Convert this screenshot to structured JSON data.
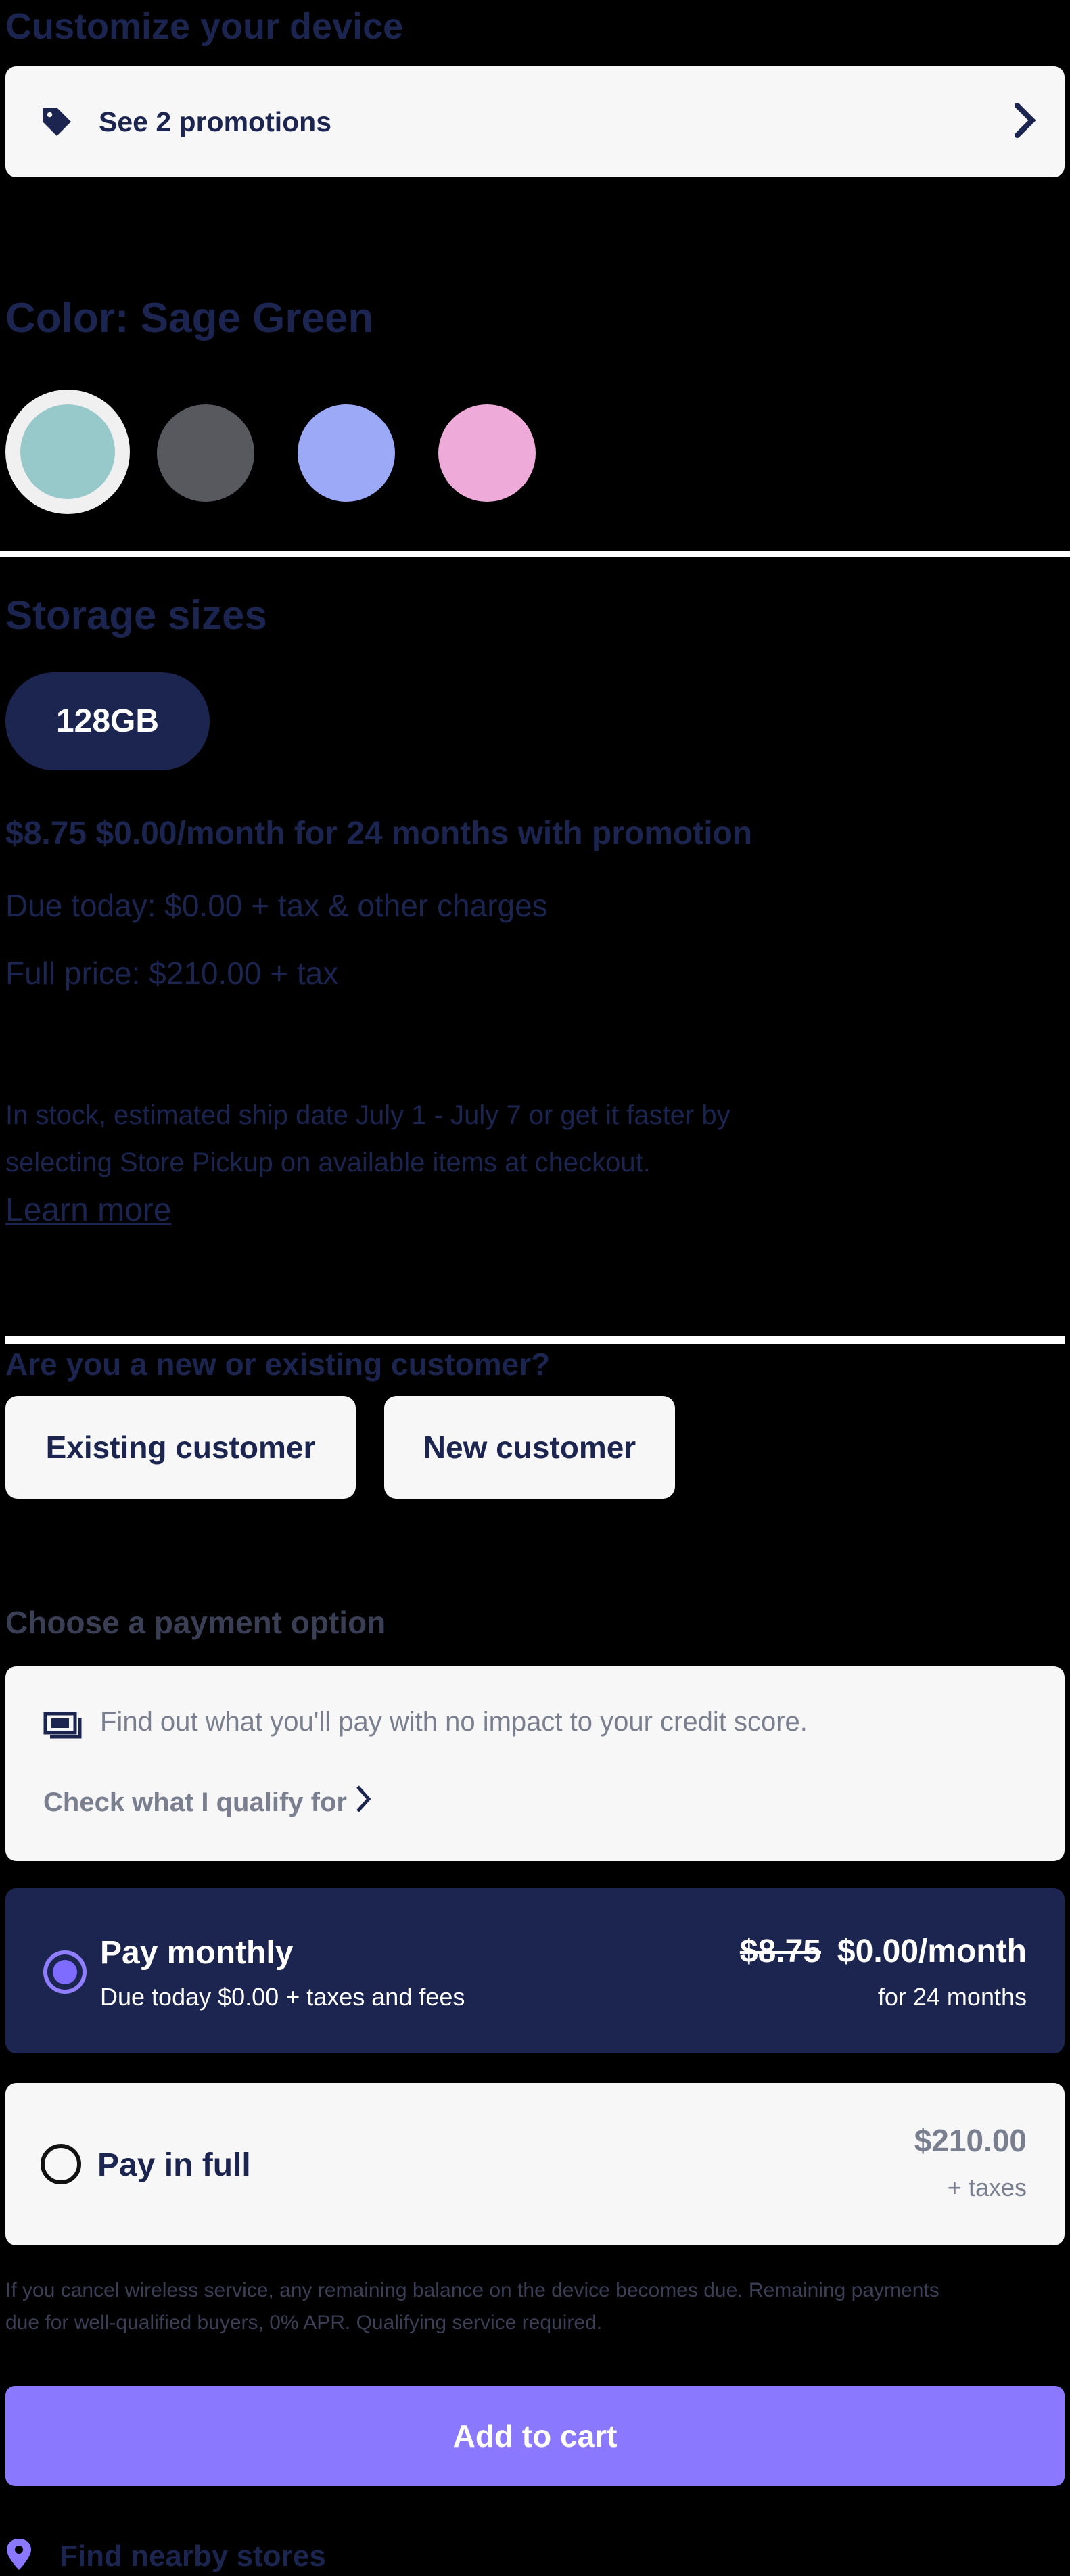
{
  "section_customize": {
    "title": "Customize your device"
  },
  "promotions": {
    "label": "See 2 promotions"
  },
  "color": {
    "title": "Color: Sage Green",
    "swatches": [
      {
        "name": "Sage Green",
        "hex": "#97c9cb",
        "selected": true
      },
      {
        "name": "Graphite",
        "hex": "#57595e",
        "selected": false
      },
      {
        "name": "Periwinkle",
        "hex": "#9ba9f7",
        "selected": false
      },
      {
        "name": "Pink",
        "hex": "#eeaad8",
        "selected": false
      }
    ]
  },
  "storage": {
    "title": "Storage sizes",
    "option": "128GB",
    "promo_price": "$8.75 $0.00/month for 24 months with promotion",
    "due_today": "Due today: $0.00 + tax & other charges",
    "full_price": "Full price: $210.00 + tax",
    "stock_line1": "In stock, estimated ship date July 1 - July 7 or get it faster by",
    "stock_line2": "selecting Store Pickup on available items at checkout.",
    "learn_more": "Learn more"
  },
  "customer": {
    "question": "Are you a new or existing customer?",
    "existing": "Existing customer",
    "new": "New customer"
  },
  "payment": {
    "title": "Choose a payment option",
    "credit_text": "Find out what you'll pay with no impact to your credit score.",
    "qualify_link": "Check what I qualify for",
    "monthly": {
      "label": "Pay monthly",
      "sub": "Due today $0.00 + taxes and fees",
      "old_price": "$8.75",
      "new_price": "$0.00/month",
      "term": "for 24 months"
    },
    "full": {
      "label": "Pay in full",
      "price": "$210.00",
      "sub": "+ taxes"
    },
    "disclaimer_line1": "If you cancel wireless service, any remaining balance on the device becomes due. Remaining payments",
    "disclaimer_line2": "due for well-qualified buyers, 0% APR. Qualifying service required."
  },
  "cart": {
    "label": "Add to cart"
  },
  "stores": {
    "label": "Find nearby stores"
  },
  "colors": {
    "navy": "#1b2550",
    "accent": "#8a78ff",
    "radio_fill": "#7d6cff",
    "card_bg": "#f7f7f8"
  }
}
